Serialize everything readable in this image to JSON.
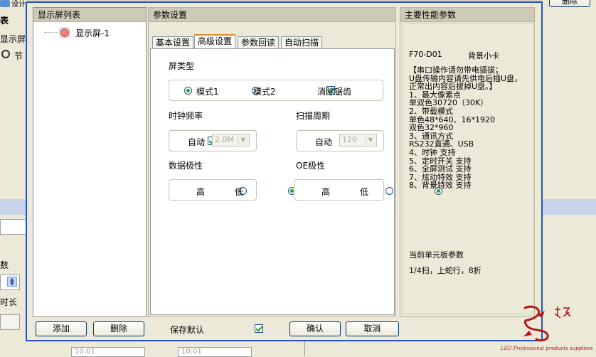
{
  "background_app": {
    "top_left_label": "设计",
    "top_right_button": "删除",
    "left_header": "表",
    "left_item1": "显示屏-",
    "left_item2": "节",
    "left_label1": "数",
    "left_label2": "时长",
    "bottom_time1": "10:01",
    "bottom_time2": "10:01"
  },
  "list_panel": {
    "title": "显示屏列表",
    "items": [
      {
        "label": "显示屏-1"
      }
    ],
    "add_button": "添加",
    "delete_button": "删除"
  },
  "param_panel": {
    "title": "参数设置",
    "tabs": [
      "基本设置",
      "高级设置",
      "参数回读",
      "自动扫描"
    ],
    "active_tab": 1,
    "screen_type": {
      "label": "屏类型",
      "mode1": "模式1",
      "mode2": "模式2",
      "anti_alias": "消除锯齿",
      "selected": "mode1",
      "anti_alias_checked": true
    },
    "clock": {
      "label": "时钟频率",
      "auto_label": "自动",
      "auto_checked": true,
      "value": "2.0M"
    },
    "scan": {
      "label": "扫描周期",
      "auto_label": "自动",
      "auto_checked": true,
      "value": "120"
    },
    "data_polarity": {
      "label": "数据极性",
      "high": "高",
      "low": "低",
      "selected": "low"
    },
    "oe_polarity": {
      "label": "OE极性",
      "high": "高",
      "low": "低",
      "selected": "low"
    }
  },
  "perf_panel": {
    "title": "主要性能参数",
    "model": "F70-D01",
    "card_type": "背景小卡",
    "spec_lines": [
      "【串口操作请勿带电插拔；",
      "U盘传输内容请先供电后插U盘，",
      "正常出内容后拔掉U盘。】",
      "1、最大像素点",
      "单双色30720（30K）",
      "2、带载模式",
      "单色48*640、16*1920",
      "双色32*960",
      "3、通讯方式",
      "RS232直通、USB",
      "4、时钟 支持",
      "5、定时开关 支持",
      "6、全屏测试 支持",
      "7、炫动特效 支持",
      "8、背景特效 支持"
    ],
    "unit_board_title": "当前单元板参数",
    "unit_board_value": "1/4扫，上蛇行，8折"
  },
  "footer": {
    "save_default": "保存默认",
    "save_default_checked": true,
    "ok_button": "确认",
    "cancel_button": "取消"
  },
  "watermark": {
    "text": "LED Professional products suppliers"
  }
}
